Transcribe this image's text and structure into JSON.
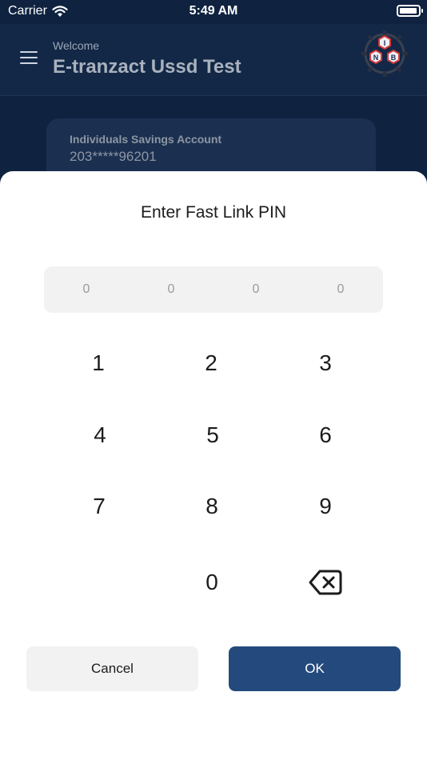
{
  "status_bar": {
    "carrier": "Carrier",
    "time": "5:49 AM",
    "battery_level": 0.95
  },
  "header": {
    "welcome": "Welcome",
    "title": "E-tranzact Ussd Test",
    "logo_letters": [
      "I",
      "N",
      "B"
    ]
  },
  "account": {
    "name": "Individuals Savings Account",
    "number": "203*****96201"
  },
  "dialog": {
    "title": "Enter Fast Link PIN",
    "pin_placeholders": [
      "0",
      "0",
      "0",
      "0"
    ],
    "keys": [
      "1",
      "2",
      "3",
      "4",
      "5",
      "6",
      "7",
      "8",
      "9",
      "0"
    ],
    "cancel_label": "Cancel",
    "ok_label": "OK"
  },
  "colors": {
    "primary": "#244a7d",
    "header_bg": "#132847",
    "background": "#0f2340"
  }
}
